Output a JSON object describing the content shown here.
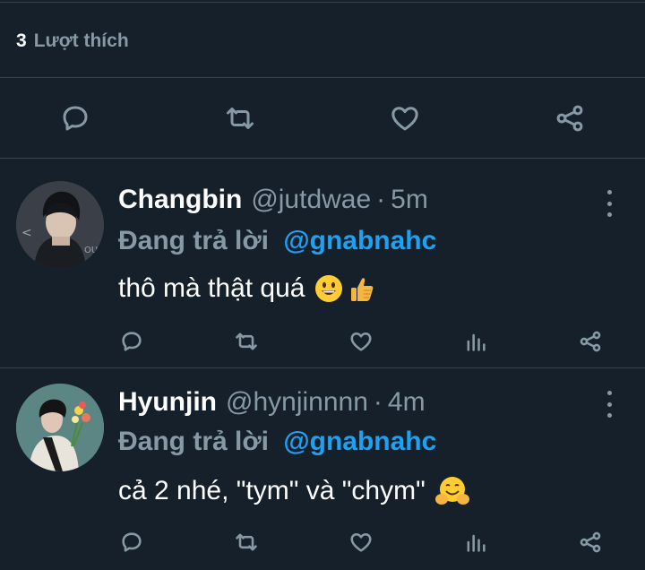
{
  "likes": {
    "count": "3",
    "label": "Lượt thích"
  },
  "colors": {
    "background": "#15202b",
    "divider": "#38444d",
    "muted": "#8899a6",
    "accent": "#1da1f2",
    "text": "#ffffff"
  },
  "main_actions": [
    {
      "icon": "reply-icon"
    },
    {
      "icon": "retweet-icon"
    },
    {
      "icon": "like-icon"
    },
    {
      "icon": "share-icon"
    }
  ],
  "tweets": [
    {
      "name": "Changbin",
      "handle": "@jutdwae",
      "dot": "·",
      "time": "5m",
      "reply_label": "Đang trả lời",
      "reply_handle": "@gnabnahc",
      "text": "thô mà thật quá",
      "emojis": [
        "grinning-face",
        "thumbs-up"
      ]
    },
    {
      "name": "Hyunjin",
      "handle": "@hynjinnnn",
      "dot": "·",
      "time": "4m",
      "reply_label": "Đang trả lời",
      "reply_handle": "@gnabnahc",
      "text": "cả 2 nhé, \"tym\" và \"chym\"",
      "emojis": [
        "hugging-face"
      ]
    }
  ]
}
